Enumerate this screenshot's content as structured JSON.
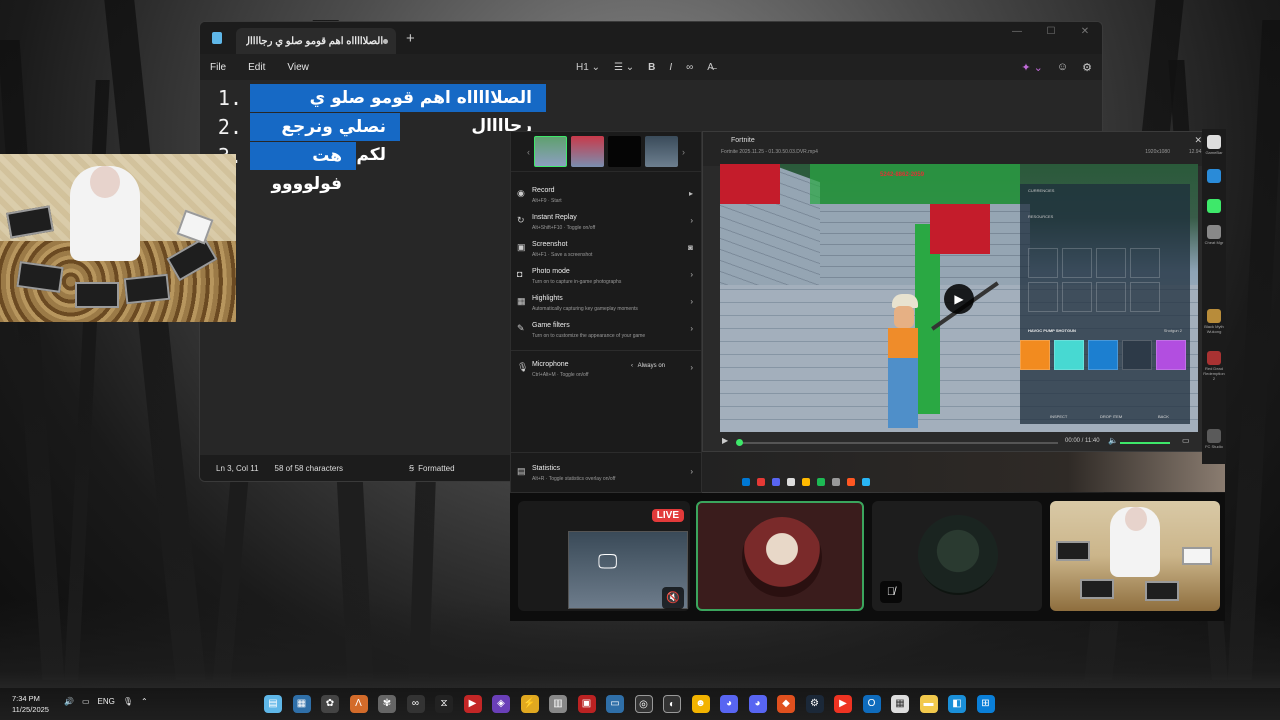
{
  "notepad": {
    "tab_title": "الصلاااااه اهم قومو صلو ي رجاااال",
    "menu": [
      "File",
      "Edit",
      "View"
    ],
    "heading_label": "H1",
    "lines": [
      {
        "num": "1.",
        "text": "الصلاااااه اهم قومو صلو ي رجاااال"
      },
      {
        "num": "2.",
        "text": "نصلي ونرجع لكم"
      },
      {
        "num": "3.",
        "text": "هت فولوووو"
      }
    ],
    "status": {
      "position": "Ln 3, Col 11",
      "chars": "58 of 58 characters",
      "mode": "Formatted"
    }
  },
  "gamebar": {
    "items": [
      {
        "icon": "record-icon",
        "title": "Record",
        "sub": "Alt+F9 · Start"
      },
      {
        "icon": "instant-replay-icon",
        "title": "Instant Replay",
        "sub": "Alt+Shift+F10 · Toggle on/off"
      },
      {
        "icon": "screenshot-icon",
        "title": "Screenshot",
        "sub": "Alt+F1 · Save a screenshot"
      },
      {
        "icon": "photo-mode-icon",
        "title": "Photo mode",
        "sub": "Turn on to capture in-game photographs"
      },
      {
        "icon": "highlights-icon",
        "title": "Highlights",
        "sub": "Automatically capturing key gameplay moments"
      },
      {
        "icon": "game-filters-icon",
        "title": "Game filters",
        "sub": "Turn on to customize the appearance of your game"
      }
    ],
    "microphone": {
      "title": "Microphone",
      "sub": "Ctrl+Alt+M · Toggle on/off",
      "value": "Always on"
    },
    "statistics": {
      "title": "Statistics",
      "sub": "Alt+R · Toggle statistics overlay on/off"
    }
  },
  "player": {
    "title": "Fortnite",
    "file": "Fortnite 2025.11.25 - 01.30.50.03.DVR.mp4",
    "resolution": "1920x1080",
    "size": "12.94 GB",
    "time": "00:00 / 11:40",
    "hud_top": "5242-8862-2059",
    "weapon": "HAVOC PUMP SHOTGUN",
    "inv_tab": "CURRENCIES",
    "inv_resources": "RESOURCES",
    "inv_actions": [
      "INSPECT",
      "DROP ITEM",
      "BACK"
    ],
    "shotgun_label": "Shotgun 2"
  },
  "call": {
    "live_label": "LIVE"
  },
  "rstrip": [
    "GameBar",
    "Cheat Mgr",
    "Black Myth Wukong",
    "Red Dead Redemption 2",
    "FC Studio"
  ],
  "taskbar": {
    "time": "7:34 PM",
    "date": "11/25/2025",
    "lang": "ENG"
  },
  "colors": {
    "selection": "#1669c5",
    "live": "#e23a3a",
    "active_speaker": "#3ba55d"
  }
}
